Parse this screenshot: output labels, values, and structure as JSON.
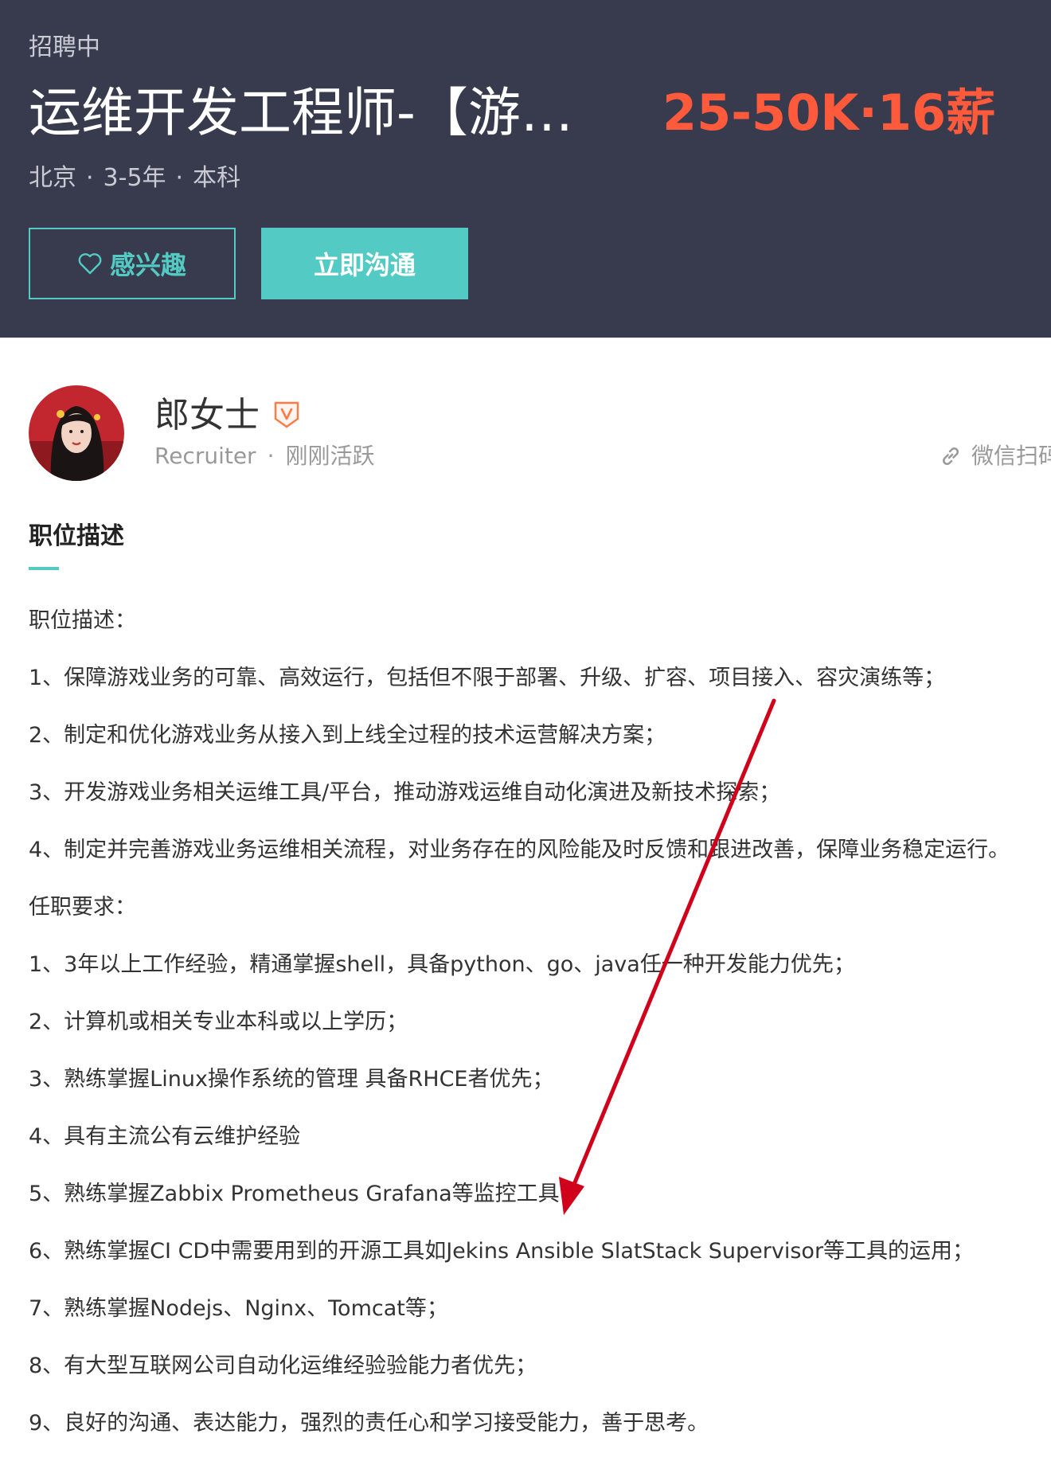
{
  "header": {
    "status": "招聘中",
    "title": "运维开发工程师-【游戏…",
    "salary": "25-50K·16薪",
    "location": "北京",
    "experience": "3-5年",
    "education": "本科",
    "separator": "·"
  },
  "actions": {
    "interest_label": "感兴趣",
    "chat_label": "立即沟通"
  },
  "recruiter": {
    "name": "郎女士",
    "role": "Recruiter",
    "separator": "·",
    "activity": "刚刚活跃",
    "wechat_label": "微信扫码"
  },
  "section": {
    "title": "职位描述"
  },
  "description": [
    "职位描述：",
    "1、保障游戏业务的可靠、高效运行，包括但不限于部署、升级、扩容、项目接入、容灾演练等；",
    "2、制定和优化游戏业务从接入到上线全过程的技术运营解决方案；",
    "3、开发游戏业务相关运维工具/平台，推动游戏运维自动化演进及新技术探索；",
    "4、制定并完善游戏业务运维相关流程，对业务存在的风险能及时反馈和跟进改善，保障业务稳定运行。",
    "任职要求：",
    "1、3年以上工作经验，精通掌握shell，具备python、go、java任一种开发能力优先；",
    "2、计算机或相关专业本科或以上学历；",
    "3、熟练掌握Linux操作系统的管理 具备RHCE者优先；",
    "4、具有主流公有云维护经验",
    "5、熟练掌握Zabbix Prometheus Grafana等监控工具；",
    "6、熟练掌握CI CD中需要用到的开源工具如Jekins Ansible SlatStack Supervisor等工具的运用；",
    "7、熟练掌握Nodejs、Nginx、Tomcat等；",
    "8、有大型互联网公司自动化运维经验验能力者优先；",
    "9、良好的沟通、表达能力，强烈的责任心和学习接受能力，善于思考。"
  ],
  "colors": {
    "header_bg": "#383b4d",
    "accent": "#53cac3",
    "salary": "#ff5a3c",
    "annotation_arrow": "#d0021b"
  },
  "icons": {
    "interest": "heart-outline-icon",
    "verified": "verified-v-badge-icon",
    "wechat": "link-icon"
  }
}
